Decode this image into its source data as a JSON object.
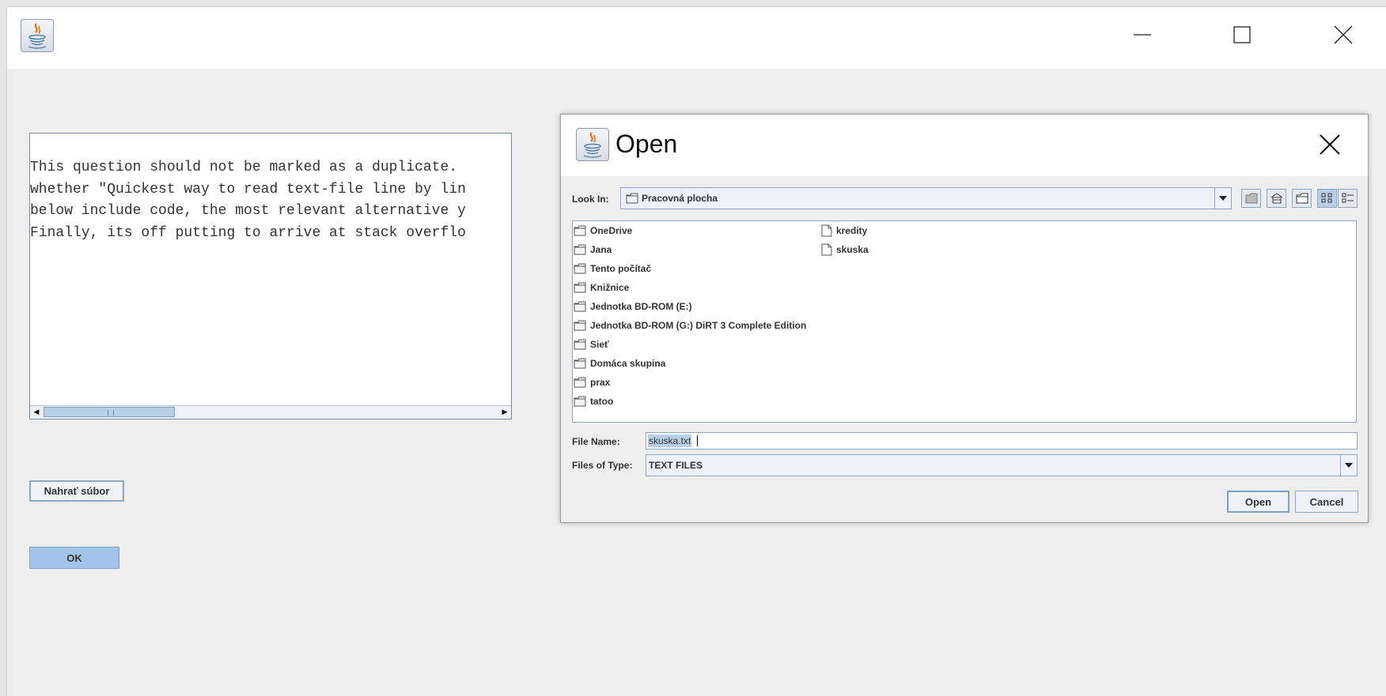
{
  "window": {
    "app_icon": "java-coffee-icon",
    "controls": [
      "minimize-icon",
      "maximize-icon",
      "close-icon"
    ]
  },
  "text_area": {
    "lines": [
      "This question should not be marked as a duplicate. ",
      "whether \"Quickest way to read text-file line by lin",
      "below include code, the most relevant alternative y",
      "Finally, its off putting to arrive at stack overflo"
    ]
  },
  "buttons": {
    "upload_label": "Nahrať súbor",
    "ok_label": "OK"
  },
  "dialog": {
    "title": "Open",
    "look_in_label": "Look In:",
    "look_in_value": "Pracovná plocha",
    "toolbar_icons": [
      "up-folder-icon",
      "home-icon",
      "new-folder-icon",
      "list-view-icon",
      "details-view-icon"
    ],
    "folders": [
      "OneDrive",
      "Jana",
      "Tento počítač",
      "Knižnice",
      "Jednotka BD-ROM (E:)",
      "Jednotka BD-ROM (G:) DiRT 3 Complete Edition",
      "Sieť",
      "Domáca skupina",
      "prax",
      "tatoo"
    ],
    "files": [
      "kredity",
      "skuska"
    ],
    "file_name_label": "File Name:",
    "file_name_value": "skuska.txt",
    "files_of_type_label": "Files of Type:",
    "files_of_type_value": "TEXT FILES",
    "open_label": "Open",
    "cancel_label": "Cancel"
  },
  "colors": {
    "accent": "#a3c4e8",
    "border": "#8ea6c0",
    "background": "#eeeeee"
  }
}
